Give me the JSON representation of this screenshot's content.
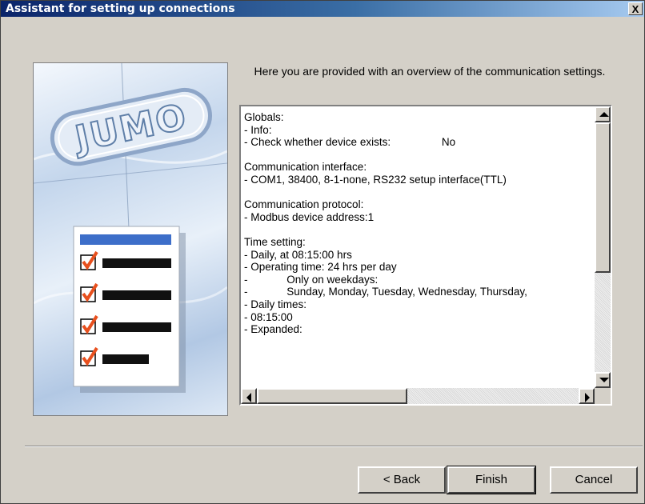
{
  "window": {
    "title": "Assistant for setting up connections",
    "close_glyph": "X"
  },
  "illustration": {
    "logo_text": "JUMO",
    "icon": "checklist-icon"
  },
  "intro": "Here you are provided with an overview of the communication settings.",
  "overview": {
    "lines": [
      "Globals:",
      "- Info:",
      "- Check whether device exists:                 No",
      "",
      "Communication interface:",
      "- COM1, 38400, 8-1-none, RS232 setup interface(TTL)",
      "",
      "Communication protocol:",
      "- Modbus device address:1",
      "",
      "Time setting:",
      "- Daily, at 08:15:00 hrs",
      "- Operating time: 24 hrs per day",
      "-             Only on weekdays:",
      "-             Sunday, Monday, Tuesday, Wednesday, Thursday,",
      "- Daily times:",
      "- 08:15:00",
      "- Expanded:"
    ]
  },
  "buttons": {
    "back": "< Back",
    "finish": "Finish",
    "cancel": "Cancel"
  },
  "colors": {
    "titlebar_start": "#0a246a",
    "titlebar_end": "#a6caf0",
    "check": "#e8501e",
    "bar": "#3d6ec9"
  }
}
